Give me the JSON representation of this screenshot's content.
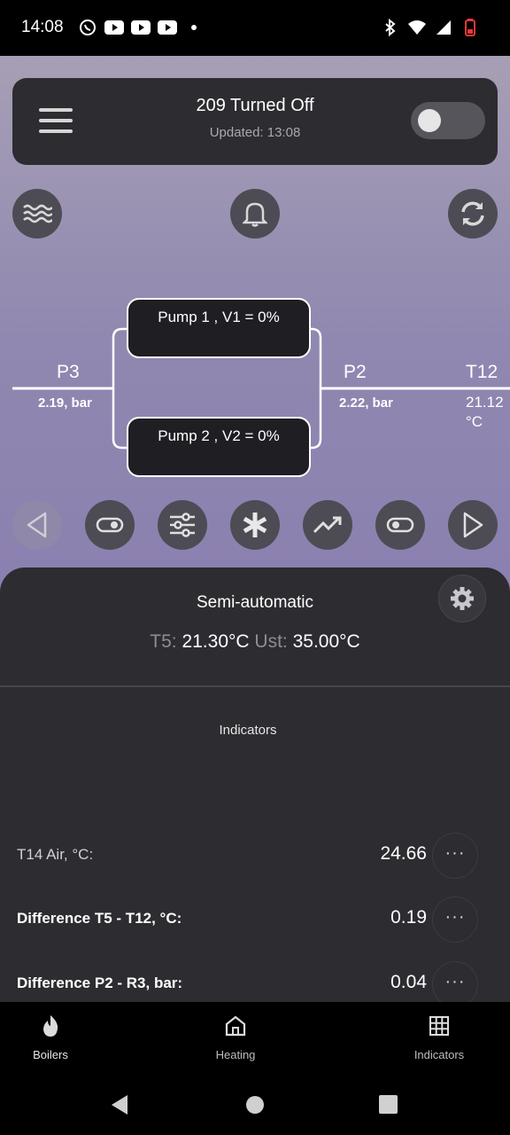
{
  "status_bar": {
    "time": "14:08",
    "left_icons": [
      "whatsapp-icon",
      "youtube-icon",
      "youtube-icon",
      "youtube-icon",
      "dot-icon"
    ],
    "right_icons": [
      "bluetooth-icon",
      "wifi-icon",
      "signal-icon",
      "battery-icon"
    ]
  },
  "header": {
    "title": "209 Turned Off",
    "subtitle": "Updated: 13:08",
    "toggle_on": false
  },
  "quick_buttons": [
    "water-waves-icon",
    "bell-icon",
    "refresh-icon"
  ],
  "diagram": {
    "pump1": "Pump 1 , V1 = 0%",
    "pump2": "Pump 2 , V2 = 0%",
    "left_sensor": {
      "name": "P3",
      "value": "2.19, bar"
    },
    "mid_sensor": {
      "name": "P2",
      "value": "2.22, bar"
    },
    "right_sensor": {
      "name": "T12",
      "value_line1": "21.12",
      "value_line2": "°C"
    }
  },
  "action_buttons": [
    "prev-icon",
    "toggle-icon",
    "sliders-icon",
    "snowflake-icon",
    "trend-icon",
    "toggle-icon",
    "next-icon"
  ],
  "panel": {
    "mode": "Semi-automatic",
    "t5_label": "T5:",
    "t5_value": "21.30°C",
    "ust_label": "Ust:",
    "ust_value": "35.00°C",
    "indicators_title": "Indicators",
    "indicators": [
      {
        "label": "T14 Air, °C:",
        "value": "24.66",
        "more": "···"
      },
      {
        "label": "Difference T5 - T12, °C:",
        "value": "0.19",
        "more": "···"
      },
      {
        "label": "Difference P2 - R3, bar:",
        "value": "0.04",
        "more": "···"
      }
    ]
  },
  "bottom_nav": [
    {
      "label": "Boilers",
      "icon": "flame-icon"
    },
    {
      "label": "Heating",
      "icon": "home-icon"
    },
    {
      "label": "Indicators",
      "icon": "grid-icon"
    }
  ],
  "colors": {
    "card": "#2d2c31",
    "button": "#4d4c54",
    "gradient_top": "#a79fb5",
    "gradient_bottom": "#8b7ab0"
  }
}
